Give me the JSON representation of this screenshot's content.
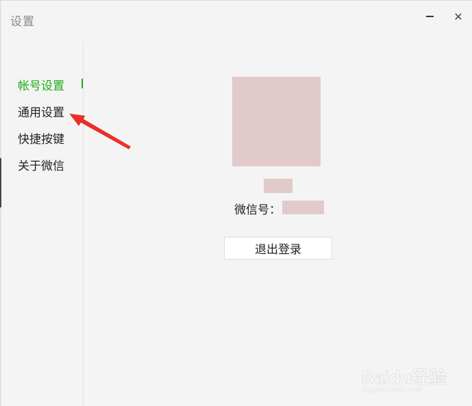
{
  "window": {
    "title": "设置",
    "minimize_symbol": "—",
    "close_symbol": "✕"
  },
  "sidebar": {
    "items": [
      {
        "label": "帐号设置",
        "active": true
      },
      {
        "label": "通用设置",
        "active": false
      },
      {
        "label": "快捷按键",
        "active": false
      },
      {
        "label": "关于微信",
        "active": false
      }
    ]
  },
  "account": {
    "wxid_label": "微信号："
  },
  "actions": {
    "logout_label": "退出登录"
  },
  "watermark": {
    "text": "Baidu经验",
    "url": "jingyan.baidu.com"
  },
  "colors": {
    "accent": "#1aad19",
    "redacted": "#e2cacb",
    "annotation_arrow": "#e8302a"
  }
}
